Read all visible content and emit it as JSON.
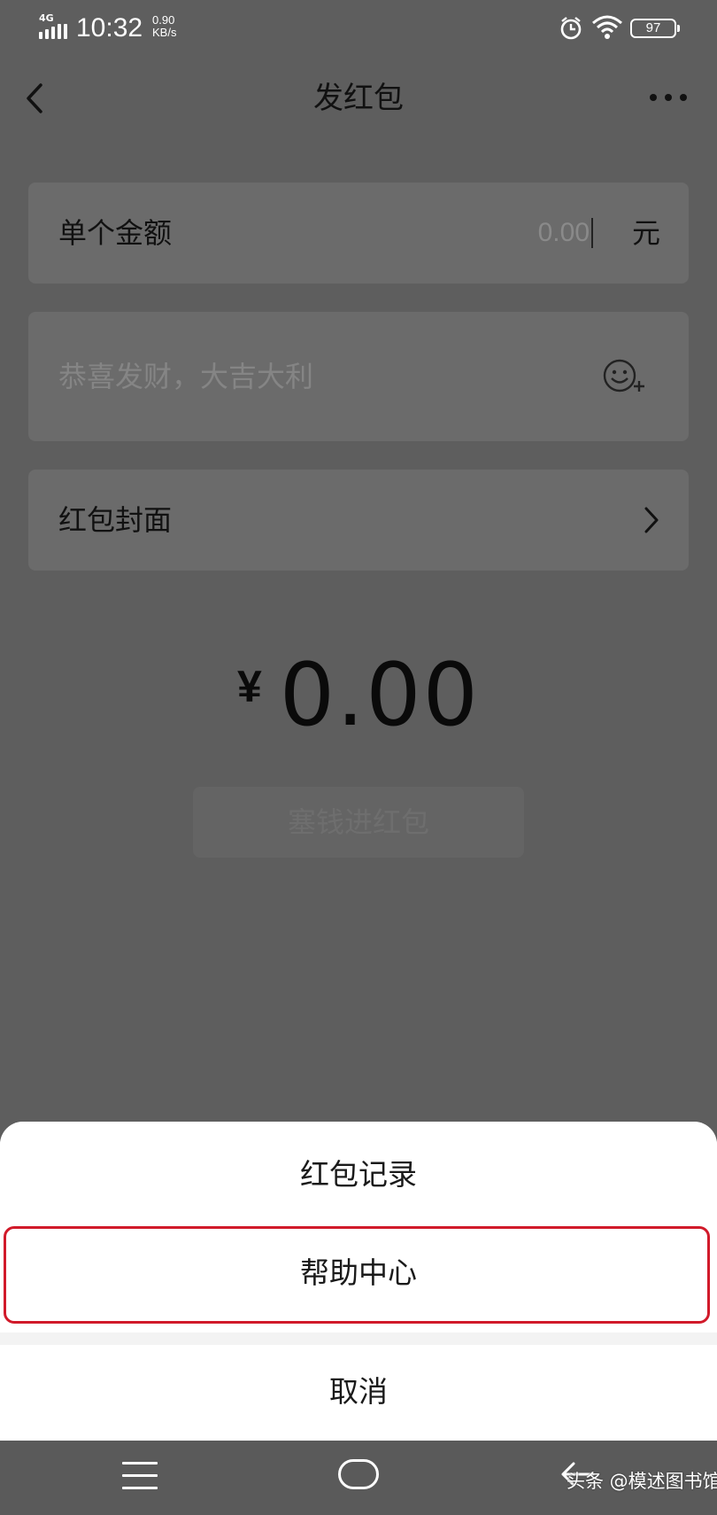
{
  "status_bar": {
    "network": "4G",
    "time": "10:32",
    "speed_value": "0.90",
    "speed_unit": "KB/s",
    "battery": "97",
    "icons": [
      "signal-icon",
      "alarm-icon",
      "wifi-icon",
      "battery-icon"
    ]
  },
  "nav": {
    "title": "发红包",
    "back_icon": "chevron-left-icon",
    "more_icon": "more-dots-icon"
  },
  "form": {
    "amount_label": "单个金额",
    "amount_placeholder": "0.00",
    "amount_unit": "元",
    "greeting_placeholder": "恭喜发财，大吉大利",
    "emoji_icon": "emoji-add-icon",
    "cover_label": "红包封面",
    "cover_icon": "chevron-right-icon"
  },
  "total": {
    "currency": "¥",
    "amount": "0.00"
  },
  "submit": {
    "label": "塞钱进红包"
  },
  "action_sheet": {
    "items": [
      {
        "label": "红包记录"
      },
      {
        "label": "帮助中心"
      }
    ],
    "cancel_label": "取消"
  },
  "watermark": {
    "text": "头条 @模述图书馆"
  },
  "colors": {
    "highlight_border": "#d11a2a",
    "overlay": "#5e5e5e",
    "sheet_bg": "#ffffff"
  }
}
